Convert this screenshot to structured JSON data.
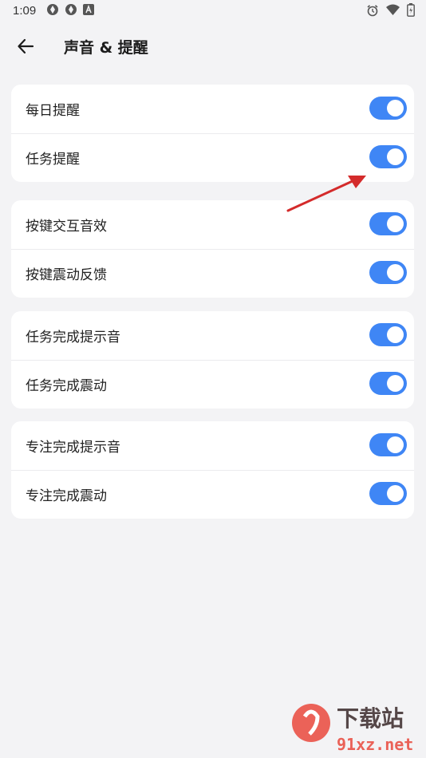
{
  "status_bar": {
    "time": "1:09",
    "left_icons": [
      "aperture-icon",
      "aperture-icon",
      "font-a-icon"
    ],
    "right_icons": [
      "alarm-icon",
      "wifi-icon",
      "battery-icon"
    ]
  },
  "header": {
    "title": "声音 & 提醒",
    "back_icon": "arrow-left-icon"
  },
  "groups": [
    {
      "items": [
        {
          "label": "每日提醒",
          "enabled": true
        },
        {
          "label": "任务提醒",
          "enabled": true
        }
      ]
    },
    {
      "items": [
        {
          "label": "按键交互音效",
          "enabled": true
        },
        {
          "label": "按键震动反馈",
          "enabled": true
        }
      ]
    },
    {
      "items": [
        {
          "label": "任务完成提示音",
          "enabled": true
        },
        {
          "label": "任务完成震动",
          "enabled": true
        }
      ]
    },
    {
      "items": [
        {
          "label": "专注完成提示音",
          "enabled": true
        },
        {
          "label": "专注完成震动",
          "enabled": true
        }
      ]
    }
  ],
  "colors": {
    "toggle_on": "#3f86f5",
    "background": "#f3f3f5",
    "card": "#ffffff",
    "annotation_arrow": "#d42b2b"
  },
  "watermark": {
    "brand": "下载站",
    "site": "91xz.net"
  }
}
